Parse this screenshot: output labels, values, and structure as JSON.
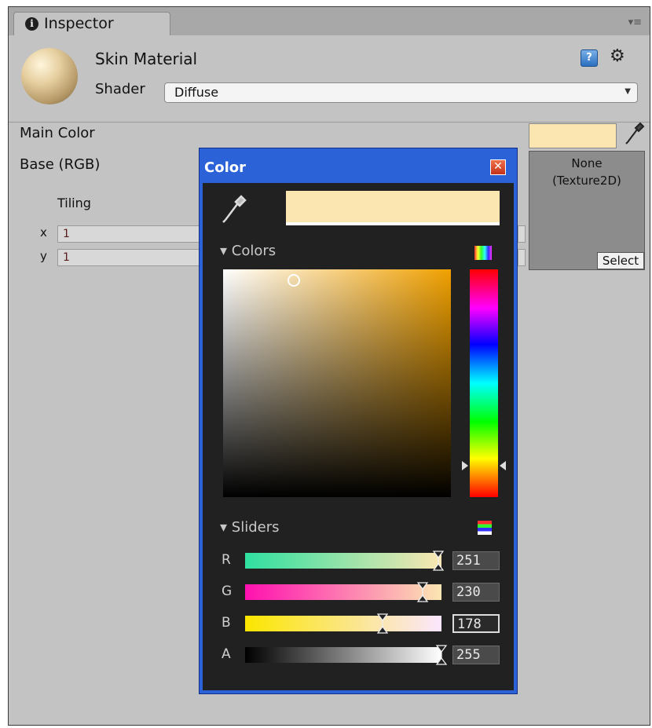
{
  "inspector": {
    "tab_label": "Inspector",
    "material_name": "Skin Material",
    "shader_label": "Shader",
    "shader_value": "Diffuse"
  },
  "properties": {
    "main_color_label": "Main Color",
    "main_color_hex": "#fbe6b2",
    "base_label": "Base (RGB)",
    "texture_slot": {
      "line1": "None",
      "line2": "(Texture2D)",
      "select_label": "Select"
    },
    "tiling_label": "Tiling",
    "x_label": "x",
    "y_label": "y",
    "tiling_x": "1",
    "tiling_y": "1"
  },
  "color_picker": {
    "title": "Color",
    "preview_hex": "#fbe6b2",
    "colors_section": "Colors",
    "sliders_section": "Sliders",
    "channels": [
      {
        "label": "R",
        "value": "251",
        "fraction": 0.984,
        "gradient": [
          "#2fe0a0",
          "#fbe6b2"
        ]
      },
      {
        "label": "G",
        "value": "230",
        "fraction": 0.902,
        "gradient": [
          "#ff10b0",
          "#fbe6b2"
        ]
      },
      {
        "label": "B",
        "value": "178",
        "fraction": 0.698,
        "gradient": [
          "#fbe600",
          "#fbe6ff"
        ]
      },
      {
        "label": "A",
        "value": "255",
        "fraction": 1.0,
        "gradient": [
          "#000000",
          "#ffffff"
        ]
      }
    ]
  },
  "colors": {
    "accent_blue": "#2c62d8",
    "panel_gray": "#c3c3c3",
    "picker_bg": "#212121"
  },
  "icons": [
    "info-icon",
    "menu-icon",
    "help-icon",
    "gear-icon",
    "eyedropper-icon",
    "close-icon",
    "color-mode-icon",
    "slider-mode-icon"
  ]
}
